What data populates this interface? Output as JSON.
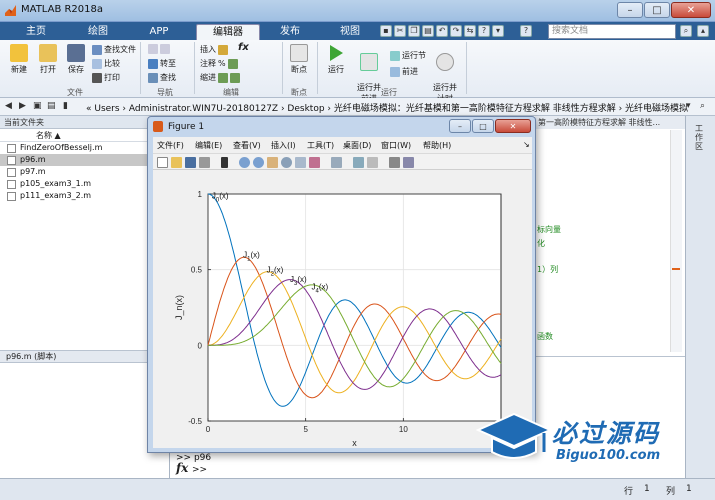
{
  "window": {
    "title": "MATLAB R2018a"
  },
  "tabs": [
    {
      "label": "主页",
      "active": false
    },
    {
      "label": "绘图",
      "active": false
    },
    {
      "label": "APP",
      "active": false
    },
    {
      "label": "编辑器",
      "active": true
    },
    {
      "label": "发布",
      "active": false
    },
    {
      "label": "视图",
      "active": false
    }
  ],
  "search": {
    "placeholder": "搜索文档"
  },
  "ribbon": {
    "new": "新建",
    "open": "打开",
    "save": "保存",
    "find_files": "查找文件",
    "compare": "比较",
    "print": "打印",
    "goto": "转至",
    "find": "查找",
    "insert": "插入",
    "fx": "fx",
    "comment": "注释",
    "comment_pct": "%",
    "indent": "缩进",
    "breakpoints": "断点",
    "run": "运行",
    "run_advance": "运行并\n前进",
    "run_section": "运行节",
    "advance": "前进",
    "run_time": "运行并\n计时",
    "groups": {
      "file": "文件",
      "navigate": "导航",
      "edit": "编辑",
      "breakpoints": "断点",
      "run": "运行"
    }
  },
  "address": {
    "path": "«  Users  ›  Administrator.WIN7U-20180127Z  ›  Desktop  ›  光纤电磁场模拟：光纤基模和第一高阶模特征方程求解 非线性方程求解  ›  光纤电磁场模拟"
  },
  "current_folder": {
    "header": "当前文件夹",
    "col_name": "名称 ▲",
    "files": [
      {
        "name": "FindZeroOfBesselj.m",
        "selected": false
      },
      {
        "name": "p96.m",
        "selected": true
      },
      {
        "name": "p97.m",
        "selected": false
      },
      {
        "name": "p105_exam3_1.m",
        "selected": false
      },
      {
        "name": "p111_exam3_2.m",
        "selected": false
      }
    ],
    "details": "p96.m  (脚本)"
  },
  "editor": {
    "tab_text": "第一高阶模特征方程求解 非线性...",
    "comments": [
      "标向量",
      "化",
      "1）列",
      "函数"
    ]
  },
  "right_panel": {
    "label": "工作区"
  },
  "command_window": {
    "lines": [
      ">> p96",
      ">>"
    ],
    "prompt": "fx"
  },
  "status": {
    "line_label": "行",
    "line_value": "1",
    "col_label": "列",
    "col_value": "1"
  },
  "figure": {
    "title": "Figure 1",
    "menu": [
      "文件(F)",
      "编辑(E)",
      "查看(V)",
      "插入(I)",
      "工具(T)",
      "桌面(D)",
      "窗口(W)",
      "帮助(H)"
    ]
  },
  "chart_data": {
    "type": "line",
    "title": "",
    "xlabel": "x",
    "ylabel": "J_n(x)",
    "xlim": [
      0,
      15
    ],
    "ylim": [
      -0.5,
      1
    ],
    "xticks": [
      0,
      5,
      10
    ],
    "yticks": [
      -0.5,
      0,
      0.5,
      1
    ],
    "grid": true,
    "series": [
      {
        "name": "J0(x)",
        "order": 0,
        "color": "#0072BD"
      },
      {
        "name": "J1(x)",
        "order": 1,
        "color": "#D95319"
      },
      {
        "name": "J2(x)",
        "order": 2,
        "color": "#EDB120"
      },
      {
        "name": "J3(x)",
        "order": 3,
        "color": "#7E2F8E"
      },
      {
        "name": "J4(x)",
        "order": 4,
        "color": "#77AC30"
      }
    ],
    "annotations": [
      {
        "base": "J",
        "sub": "0",
        "suffix": "(x)",
        "x": 0.2,
        "y": 0.97
      },
      {
        "base": "J",
        "sub": "1",
        "suffix": "(x)",
        "x": 1.8,
        "y": 0.58
      },
      {
        "base": "J",
        "sub": "2",
        "suffix": "(x)",
        "x": 3.0,
        "y": 0.48
      },
      {
        "base": "J",
        "sub": "3",
        "suffix": "(x)",
        "x": 4.2,
        "y": 0.42
      },
      {
        "base": "J",
        "sub": "4",
        "suffix": "(x)",
        "x": 5.3,
        "y": 0.37
      }
    ]
  },
  "watermark": {
    "cn": "必过源码",
    "en": "Biguo100.com"
  }
}
